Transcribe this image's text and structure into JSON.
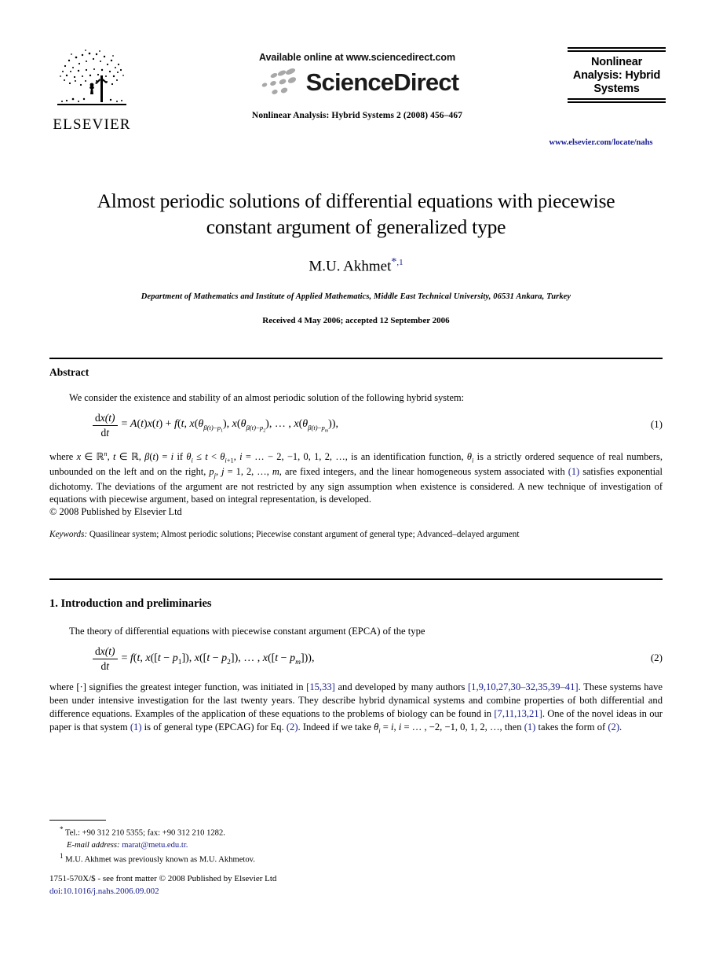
{
  "header": {
    "publisher_logo_word": "ELSEVIER",
    "available_online": "Available online at www.sciencedirect.com",
    "sciencedirect_wordmark": "ScienceDirect",
    "journal_reference": "Nonlinear Analysis: Hybrid Systems 2 (2008) 456–467",
    "journal_logo_title": "Nonlinear Analysis: Hybrid Systems",
    "journal_url": "www.elsevier.com/locate/nahs"
  },
  "title_block": {
    "title_line1": "Almost periodic solutions of differential equations with piecewise",
    "title_line2": "constant argument of generalized type",
    "author": "M.U. Akhmet",
    "author_star": "*",
    "author_footnote": "1",
    "affiliation": "Department of Mathematics and Institute of Applied Mathematics, Middle East Technical University, 06531 Ankara, Turkey",
    "received": "Received 4 May 2006; accepted 12 September 2006"
  },
  "abstract": {
    "heading": "Abstract",
    "lead": "We consider the existence and stability of an almost periodic solution of the following hybrid system:",
    "equation1_number": "(1)",
    "body_part1": "where ",
    "body_part2": " is an identification function, ",
    "body_part3": " is a strictly ordered sequence of real numbers, unbounded on the left and on the right, ",
    "body_part4": " are fixed integers, and the linear homogeneous system associated with ",
    "body_cite1": "(1)",
    "body_part5": " satisfies exponential dichotomy. The deviations of the argument are not restricted by any sign assumption when existence is considered. A new technique of investigation of equations with piecewise argument, based on integral representation, is developed.",
    "copyright": "© 2008 Published by Elsevier Ltd",
    "keywords_label": "Keywords:",
    "keywords_value": "Quasilinear system; Almost periodic solutions; Piecewise constant argument of general type; Advanced–delayed argument"
  },
  "section1": {
    "heading": "1. Introduction and preliminaries",
    "lead": "The theory of differential equations with piecewise constant argument (EPCA) of the type",
    "equation2_number": "(2)",
    "para_a": "where [·] signifies the greatest integer function, was initiated in ",
    "cite_15_33": "[15,33]",
    "para_b": " and developed by many authors ",
    "cite_list": "[1,9,10,27,30–32,35,39–41]",
    "para_c": ". These systems have been under intensive investigation for the last twenty years. They describe hybrid dynamical systems and combine properties of both differential and difference equations. Examples of the application of these equations to the problems of biology can be found in ",
    "cite_biology": "[7,11,13,21]",
    "para_d": ". One of the novel ideas in our paper is that system ",
    "cite_eq1": "(1)",
    "para_e": " is of general type (EPCAG) for Eq. ",
    "cite_eq2": "(2)",
    "para_f": ". Indeed if we take ",
    "para_g": "then ",
    "cite_eq1b": "(1)",
    "para_h": " takes the form of ",
    "cite_eq2b": "(2)",
    "para_i": "."
  },
  "footnotes": {
    "star_marker": "*",
    "tel_fax": "Tel.: +90 312 210 5355; fax: +90 312 210 1282.",
    "email_label": "E-mail address:",
    "email_value": "marat@metu.edu.tr.",
    "fn1_marker": "1",
    "fn1_text": "M.U. Akhmet was previously known as M.U. Akhmetov."
  },
  "colophon": {
    "front_matter": "1751-570X/$ - see front matter © 2008 Published by Elsevier Ltd",
    "doi": "doi:10.1016/j.nahs.2006.09.002"
  },
  "colors": {
    "link_blue": "#151b8d",
    "text_black": "#000000",
    "page_background": "#ffffff"
  }
}
